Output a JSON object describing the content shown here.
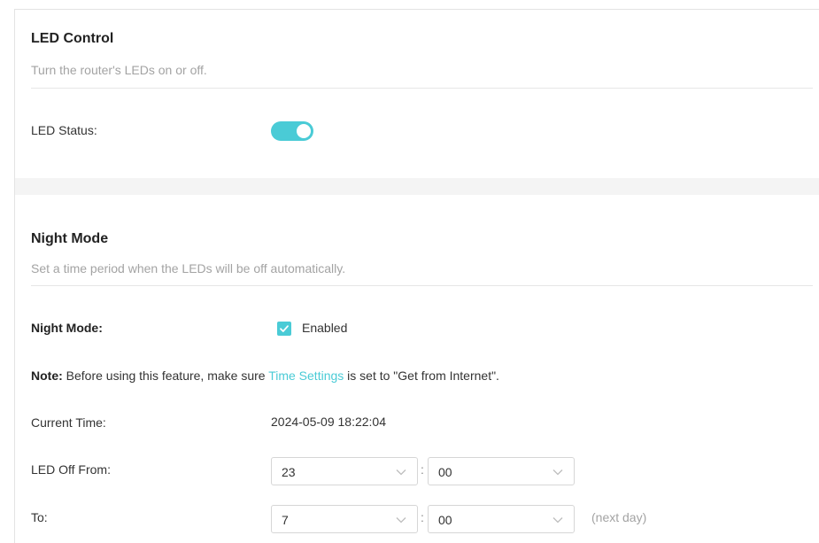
{
  "led_control": {
    "title": "LED Control",
    "description": "Turn the router's LEDs on or off.",
    "status_label": "LED Status:",
    "status_on": true
  },
  "night_mode": {
    "title": "Night Mode",
    "description": "Set a time period when the LEDs will be off automatically.",
    "mode_label": "Night Mode:",
    "enabled_label": "Enabled",
    "enabled": true,
    "note_prefix": "Note:",
    "note_before_link": " Before using this feature, make sure ",
    "note_link": "Time Settings",
    "note_after_link": " is set to \"Get from Internet\".",
    "current_time_label": "Current Time:",
    "current_time_value": "2024-05-09 18:22:04",
    "off_from_label": "LED Off From:",
    "off_from_hour": "23",
    "off_from_minute": "00",
    "to_label": "To:",
    "to_hour": "7",
    "to_minute": "00",
    "separator": ":",
    "next_day_hint": "(next day)"
  },
  "colors": {
    "accent": "#4acbd6",
    "muted_text": "#a3a3a3",
    "section_band": "#f4f4f4"
  },
  "icons": {
    "toggle_knob": "toggle-knob",
    "checkmark": "check-icon",
    "dropdown": "chevron-down-icon"
  }
}
